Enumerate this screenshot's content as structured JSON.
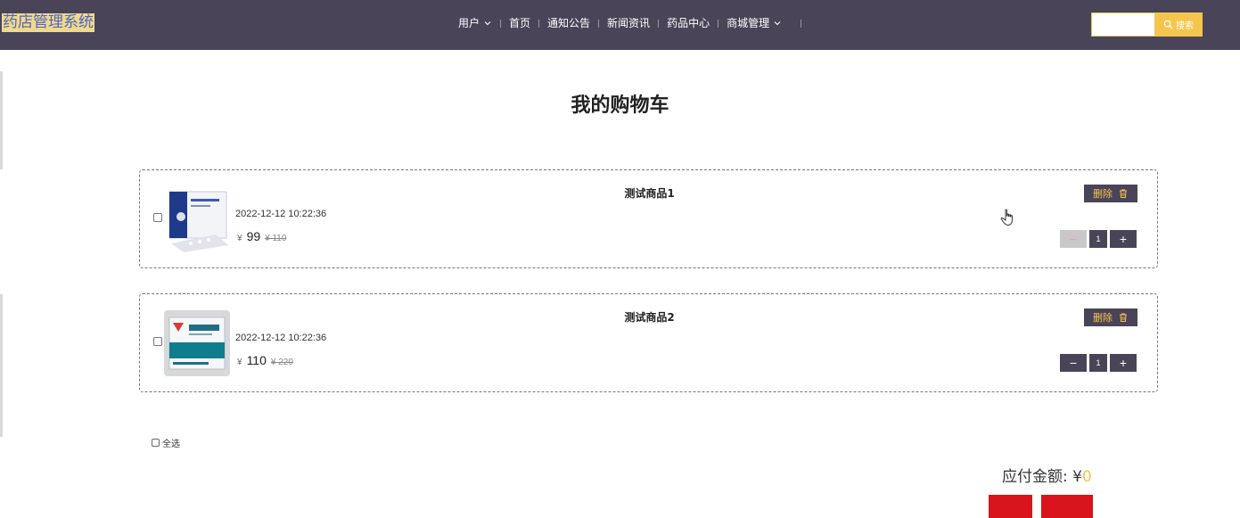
{
  "header": {
    "logo": "药店管理系统",
    "nav": [
      {
        "label": "用户",
        "dropdown": true
      },
      {
        "label": "首页",
        "dropdown": false
      },
      {
        "label": "通知公告",
        "dropdown": false
      },
      {
        "label": "新闻资讯",
        "dropdown": false
      },
      {
        "label": "药品中心",
        "dropdown": false
      },
      {
        "label": "商城管理",
        "dropdown": true
      }
    ],
    "search": {
      "value": "",
      "button_label": "搜索"
    }
  },
  "page": {
    "title": "我的购物车"
  },
  "cart": {
    "items": [
      {
        "name": "测试商品1",
        "time": "2022-12-12 10:22:36",
        "currency": "¥",
        "price": "99",
        "old_price": "¥ 110",
        "quantity": "1",
        "delete_label": "删除",
        "minus_disabled": true,
        "checked": false
      },
      {
        "name": "测试商品2",
        "time": "2022-12-12 10:22:36",
        "currency": "¥",
        "price": "110",
        "old_price": "¥ 220",
        "quantity": "1",
        "delete_label": "删除",
        "minus_disabled": false,
        "checked": false
      }
    ]
  },
  "footer": {
    "select_all_label": "全选",
    "total_label": "应付金额: ¥",
    "total_value": "0"
  },
  "colors": {
    "header_bg": "#4a4458",
    "accent": "#f5c54e",
    "danger": "#d9141a"
  }
}
